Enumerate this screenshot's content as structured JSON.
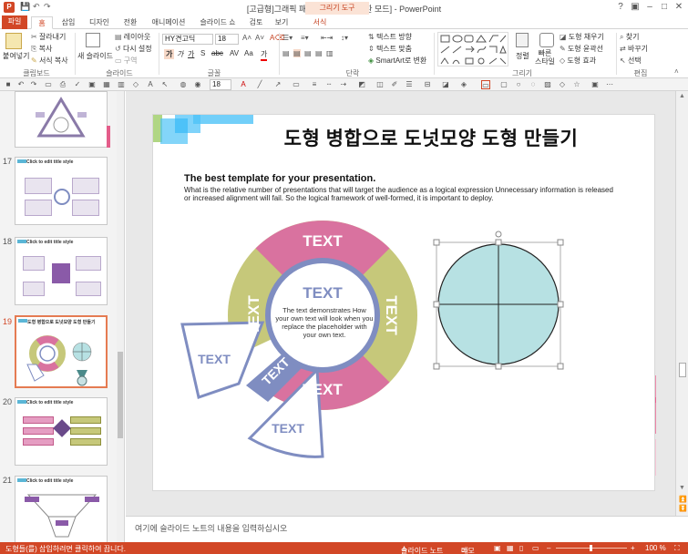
{
  "window": {
    "title": "[고급형]그래픽 패턴의 반복.ppt [호환 모드] - PowerPoint",
    "context_tab": "그리기 도구",
    "help": "?"
  },
  "tabs": [
    "파일",
    "홈",
    "삽입",
    "디자인",
    "전환",
    "애니메이션",
    "슬라이드 쇼",
    "검토",
    "보기",
    "서식"
  ],
  "ribbon": {
    "clipboard": {
      "paste": "붙여넣기",
      "cut": "잘라내기",
      "copy": "복사",
      "format_painter": "서식 복사",
      "group": "클립보드"
    },
    "slides": {
      "new_slide": "새 슬라이드",
      "layout": "레이아웃",
      "reset": "다시 설정",
      "section": "구역",
      "group": "슬라이드"
    },
    "font": {
      "name": "HY견고딕",
      "size": "18",
      "group": "글꼴",
      "bold": "가",
      "italic": "가",
      "underline": "가",
      "shadow": "S",
      "strike": "abc",
      "charspace": "AV",
      "case": "Aa",
      "color": "가"
    },
    "paragraph": {
      "direction": "텍스트 방향",
      "align": "텍스트 맞춤",
      "smartart": "SmartArt로 변환",
      "group": "단락"
    },
    "drawing": {
      "arrange": "정렬",
      "quick_styles": "빠른 스타일",
      "fill": "도형 채우기",
      "outline": "도형 윤곽선",
      "effects": "도형 효과",
      "group": "그리기"
    },
    "editing": {
      "find": "찾기",
      "replace": "바꾸기",
      "select": "선택",
      "group": "편집"
    }
  },
  "quick_toolbar": {
    "font_size": "18"
  },
  "thumbnails": [
    {
      "num": "",
      "title": ""
    },
    {
      "num": "17",
      "title": "Click to edit title style"
    },
    {
      "num": "18",
      "title": "Click to edit title style"
    },
    {
      "num": "19",
      "title": "도형 병합으로 도넛모양 도형 만들기"
    },
    {
      "num": "20",
      "title": "Click to edit title style"
    },
    {
      "num": "21",
      "title": "Click to edit title style"
    }
  ],
  "slide": {
    "title": "도형 병합으로 도넛모양 도형 만들기",
    "subtitle": "The best template for your presentation.",
    "body": "What is the relative number of presentations that will target the audience as a logical expression Unnecessary information is released or increased alignment will fail. So the logical framework of well-formed, it is important to deploy.",
    "donut": {
      "top": "TEXT",
      "right": "TEXT",
      "bottom": "TEXT",
      "left": "TEXT",
      "center_title": "TEXT",
      "center_body": "The text demonstrates How your own text will look when you replace the placeholder with your own text.",
      "pulled_left": "TEXT",
      "pulled_bottom": "TEXT",
      "pulled_diag": "TEXT"
    },
    "colors": {
      "pink": "#d9729f",
      "olive": "#c6c87a",
      "blue": "#7f8dc1",
      "circle": "#b7e1e3"
    }
  },
  "notes": {
    "placeholder": "여기에 슬라이드 노트의 내용을 입력하십시오"
  },
  "status": {
    "left": "도형들(를) 삽입하려면 클릭하여 끕니다.",
    "notes": "슬라이드 노트",
    "memo": "메모",
    "zoom": "100 %"
  }
}
